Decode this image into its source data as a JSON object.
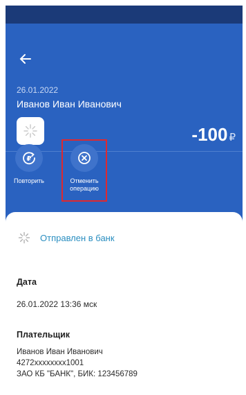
{
  "header": {
    "date": "26.01.2022",
    "name": "Иванов Иван Иванович",
    "amount": "-100",
    "currency": "₽"
  },
  "actions": [
    {
      "label": "Повторить",
      "icon": "repeat-ruble-icon"
    },
    {
      "label": "Отменить операцию",
      "icon": "cancel-x-icon"
    }
  ],
  "status": {
    "text": "Отправлен в банк",
    "icon": "pending-spinner-icon"
  },
  "details": {
    "date_title": "Дата",
    "date_value": "26.01.2022 13:36 мск",
    "payer_title": "Плательщик",
    "payer_lines": [
      "Иванов Иван Иванович",
      "4272xxxxxxxx1001",
      "ЗАО КБ \"БАНК\", БИК: 123456789"
    ]
  },
  "colors": {
    "header_bg": "#2a62c0",
    "statusbar_bg": "#1b3a78",
    "status_text": "#2a8ec0",
    "highlight": "#e0282e"
  }
}
